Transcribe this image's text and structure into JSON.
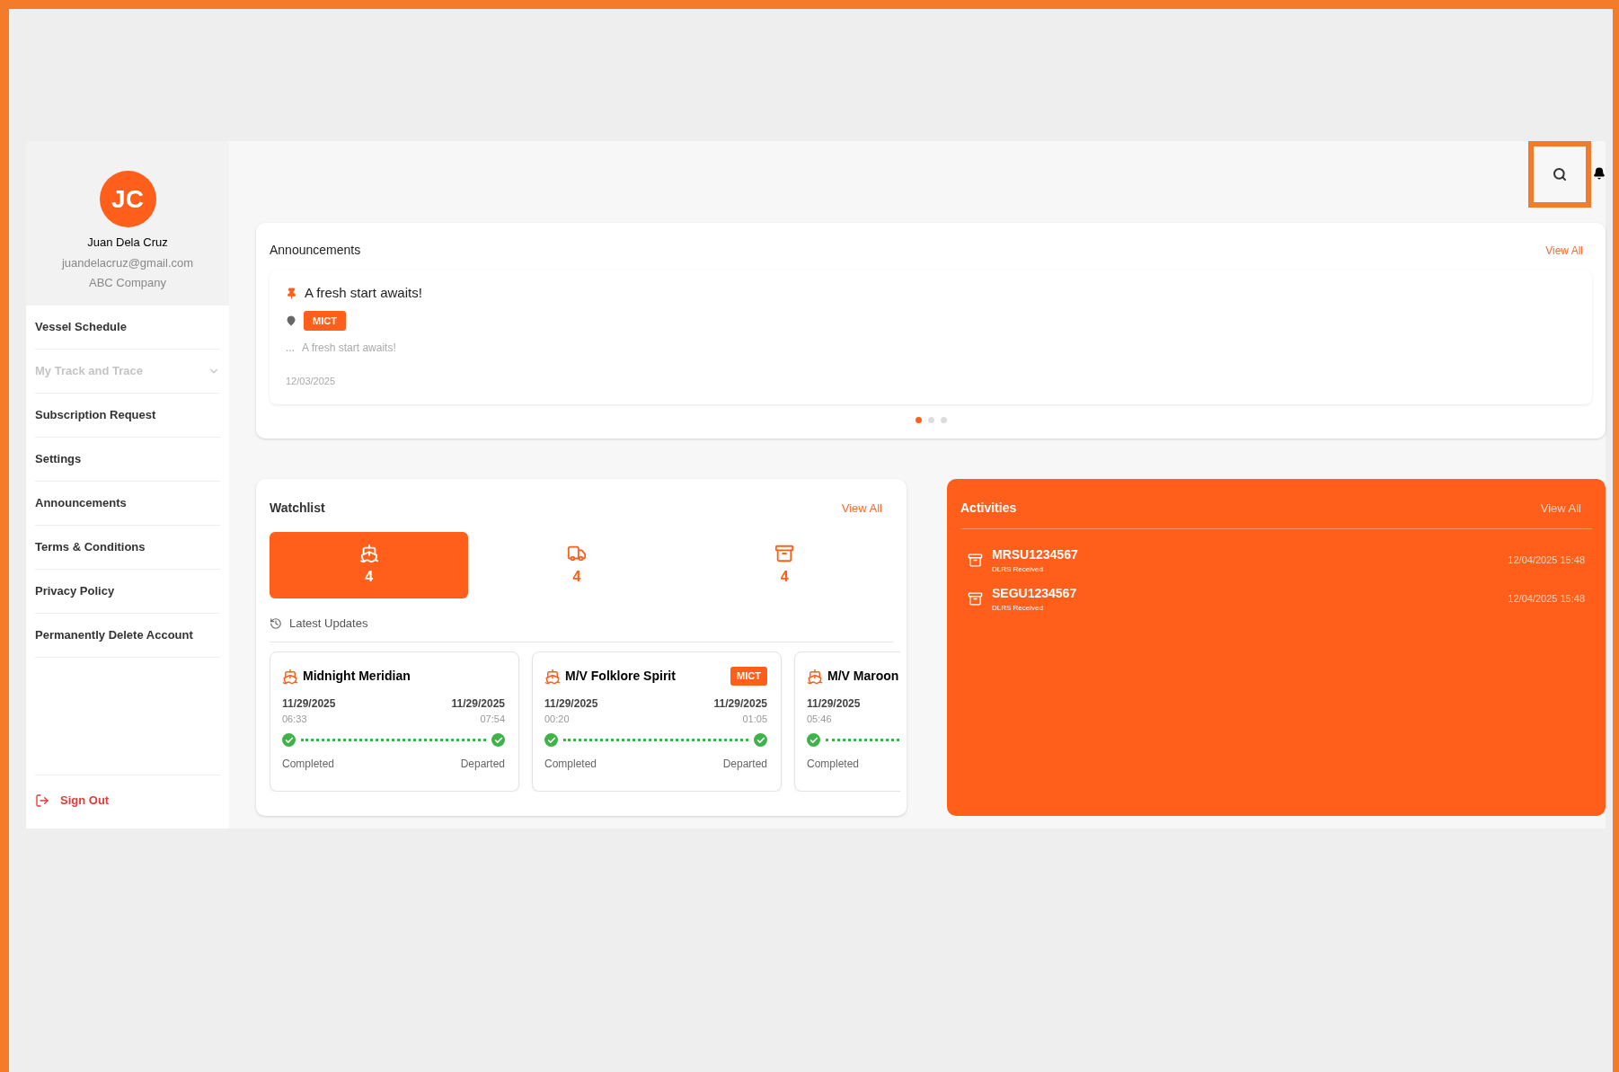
{
  "profile": {
    "initials": "JC",
    "name": "Juan Dela Cruz",
    "email": "juandelacruz@gmail.com",
    "company": "ABC Company"
  },
  "sidebar": {
    "items": [
      {
        "label": "Vessel Schedule",
        "disabled": false,
        "expandable": false
      },
      {
        "label": "My Track and Trace",
        "disabled": true,
        "expandable": true
      },
      {
        "label": "Subscription Request",
        "disabled": false,
        "expandable": false
      },
      {
        "label": "Settings",
        "disabled": false,
        "expandable": false
      },
      {
        "label": "Announcements",
        "disabled": false,
        "expandable": false
      },
      {
        "label": "Terms & Conditions",
        "disabled": false,
        "expandable": false
      },
      {
        "label": "Privacy Policy",
        "disabled": false,
        "expandable": false
      },
      {
        "label": "Permanently Delete Account",
        "disabled": false,
        "expandable": false
      }
    ],
    "sign_out": "Sign Out"
  },
  "header": {
    "search_highlighted": true
  },
  "announcements": {
    "title": "Announcements",
    "view_all": "View All",
    "item": {
      "title": "A fresh start awaits!",
      "tag": "MICT",
      "prefix": "...",
      "body": "A fresh start awaits!",
      "date": "12/03/2025"
    },
    "dots": [
      {
        "selected": true
      },
      {
        "selected": false
      },
      {
        "selected": false
      }
    ]
  },
  "watchlist": {
    "title": "Watchlist",
    "view_all": "View All",
    "tabs": [
      {
        "kind": "vessel",
        "count": "4",
        "selected": true
      },
      {
        "kind": "truck",
        "count": "4",
        "selected": false
      },
      {
        "kind": "container",
        "count": "4",
        "selected": false
      }
    ],
    "latest_updates": "Latest Updates",
    "cards": [
      {
        "name": "Midnight Meridian",
        "start_date": "11/29/2025",
        "start_time": "06:33",
        "start_status": "Completed",
        "end_date": "11/29/2025",
        "end_time": "07:54",
        "end_status": "Departed"
      },
      {
        "name": "M/V Folklore Spirit",
        "tag": "MICT",
        "start_date": "11/29/2025",
        "start_time": "00:20",
        "start_status": "Completed",
        "end_date": "11/29/2025",
        "end_time": "01:05",
        "end_status": "Departed"
      },
      {
        "name": "M/V Maroon",
        "start_date": "11/29/2025",
        "start_time": "05:46",
        "start_status": "Completed"
      }
    ]
  },
  "activities": {
    "title": "Activities",
    "view_all": "View All",
    "items": [
      {
        "code": "MRSU1234567",
        "status": "DLRS Received",
        "time": "12/04/2025 15:48"
      },
      {
        "code": "SEGU1234567",
        "status": "DLRS Received",
        "time": "12/04/2025 15:48"
      }
    ]
  }
}
